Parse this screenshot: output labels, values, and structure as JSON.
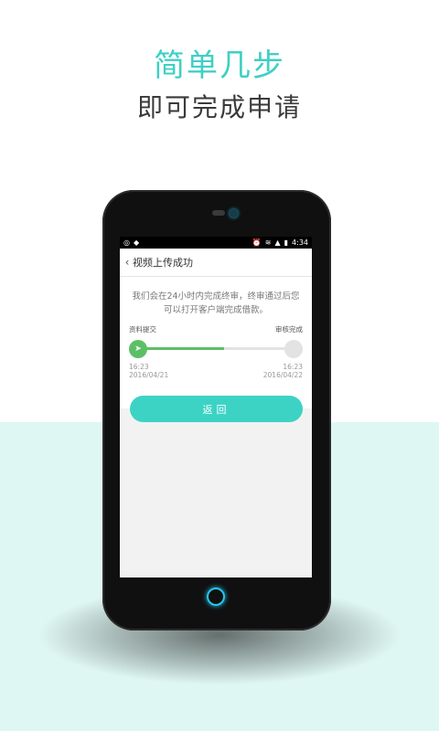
{
  "promo": {
    "headline": "简单几步",
    "subheadline": "即可完成申请",
    "accent_color": "#3fd0c3"
  },
  "status_bar": {
    "time": "4:34",
    "icons": [
      "whatsapp-icon",
      "dropbox-icon",
      "alarm-icon",
      "wifi-icon",
      "signal-icon",
      "battery-icon"
    ]
  },
  "nav": {
    "back_icon": "chevron-left-icon",
    "title": "视频上传成功"
  },
  "result": {
    "message": "我们会在24小时内完成终审，终审通过后您可以打开客户端完成借款。",
    "progress": {
      "start_label": "资料提交",
      "end_label": "审核完成",
      "start_time": "16:23",
      "start_date": "2016/04/21",
      "end_time": "16:23",
      "end_date": "2016/04/22",
      "progress_fraction": 0.55,
      "active_color": "#5cbf66"
    }
  },
  "actions": {
    "return_label": "返回"
  }
}
